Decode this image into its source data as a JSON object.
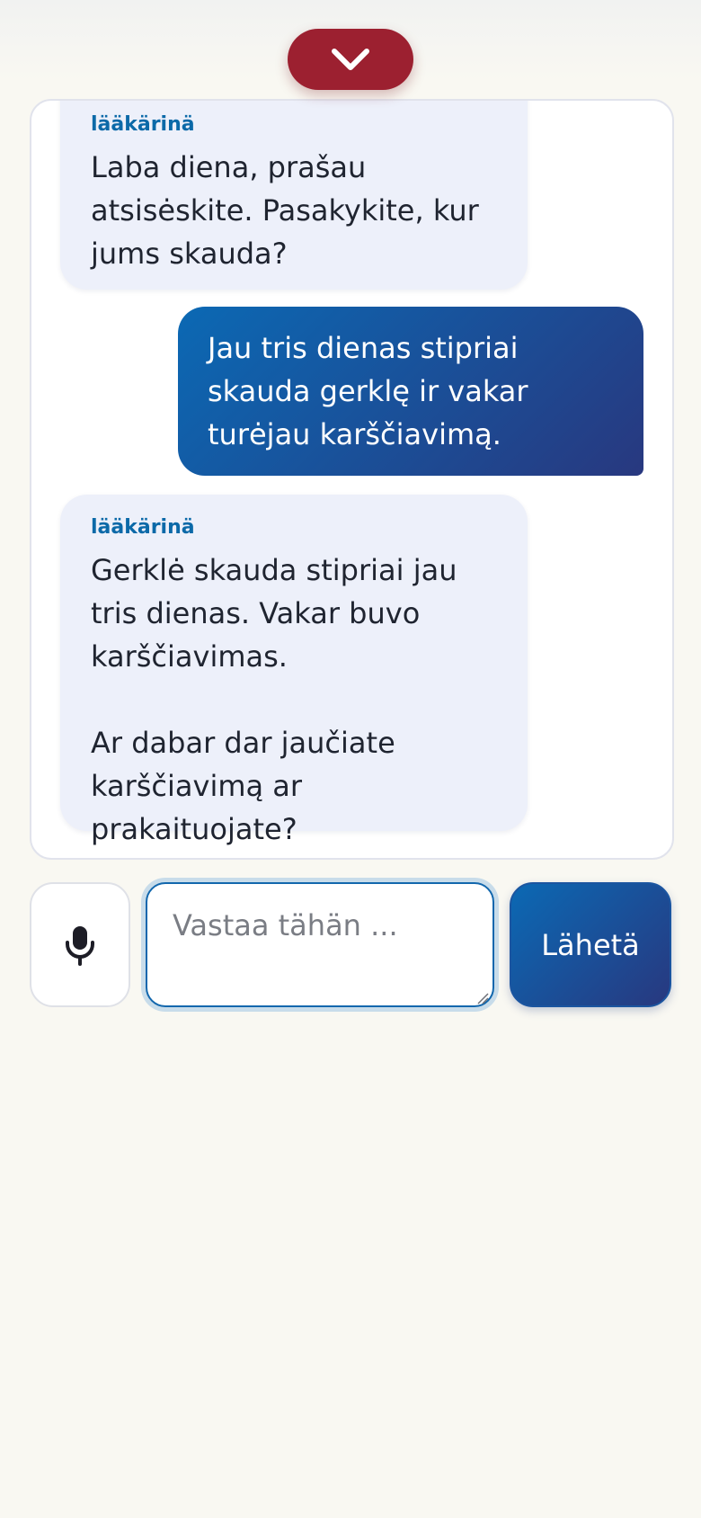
{
  "header": {
    "collapse_icon": "chevron-down-icon"
  },
  "chat": {
    "messages": [
      {
        "role": "bot",
        "sender": "lääkärinä",
        "text": "Laba diena, prašau atsisėskite. Pasakykite, kur jums skauda?"
      },
      {
        "role": "user",
        "text": "Jau tris dienas stipriai skauda gerklę ir vakar turėjau karščiavimą."
      },
      {
        "role": "bot",
        "sender": "lääkärinä",
        "text": "Gerklė skauda stipriai jau tris dienas. Vakar buvo karščiavimas.\n\nAr dabar dar jaučiate karščiavimą ar prakaituojate?"
      }
    ]
  },
  "composer": {
    "mic_icon": "microphone-icon",
    "placeholder": "Vastaa tähän ...",
    "value": "",
    "send_label": "Lähetä"
  },
  "colors": {
    "accent_red": "#9c2030",
    "accent_blue": "#0b69b4",
    "accent_blue_dark": "#28387f",
    "bot_bubble": "#edf0fa",
    "sender_label": "#0b69a8",
    "page_background": "#f9f8f2"
  }
}
